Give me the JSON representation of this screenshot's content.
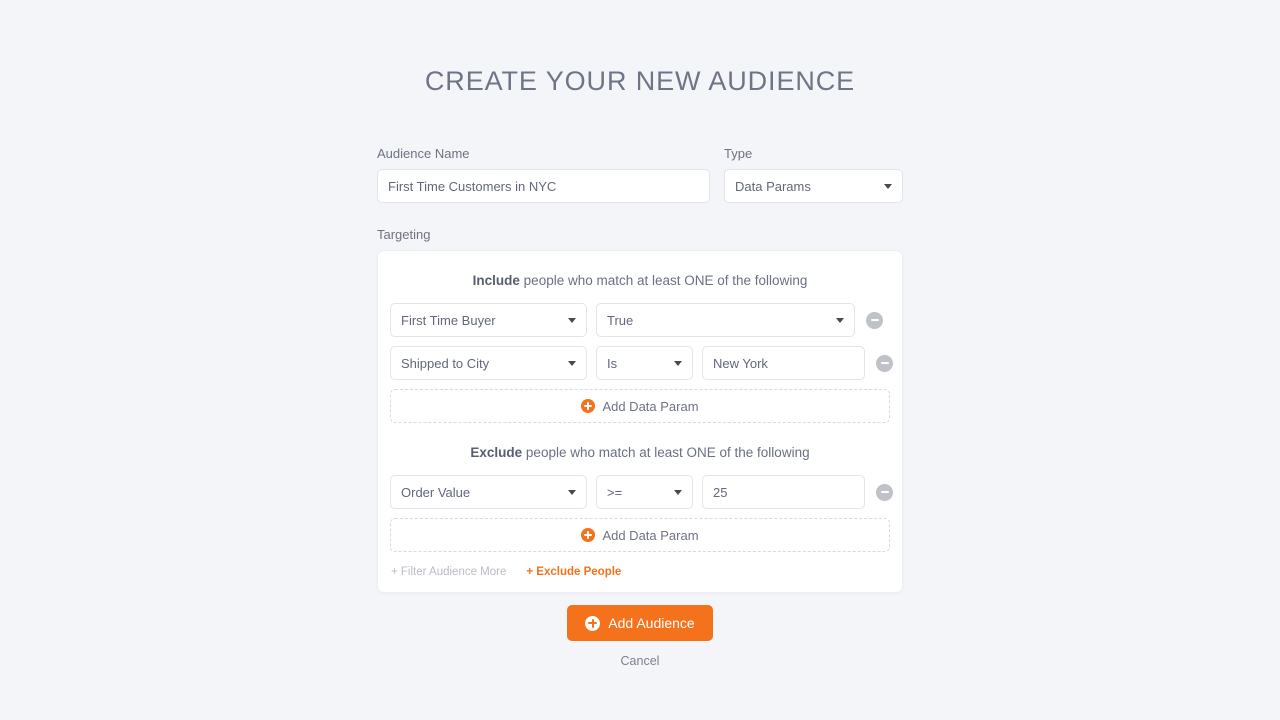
{
  "page": {
    "title": "CREATE YOUR NEW AUDIENCE",
    "background_color": "#f4f5f9",
    "accent_color": "#f4721b"
  },
  "form": {
    "audience_name": {
      "label": "Audience Name",
      "value": "First Time Customers in NYC",
      "placeholder": "Audience Name"
    },
    "type": {
      "label": "Type",
      "value": "Data Params",
      "icon": "chevron-down-icon"
    },
    "targeting_label": "Targeting"
  },
  "include_group": {
    "heading_strong": "Include",
    "heading_rest": " people who match at least ONE of the following",
    "rules": [
      {
        "param": "First Time Buyer",
        "value": "True",
        "value_is_select": true,
        "remove_icon": "minus-circle-icon"
      },
      {
        "param": "Shipped to City",
        "operator": "Is",
        "value": "New York",
        "value_is_select": false,
        "remove_icon": "minus-circle-icon"
      }
    ],
    "add_label": "Add Data Param",
    "add_icon": "plus-circle-icon"
  },
  "exclude_group": {
    "heading_strong": "Exclude",
    "heading_rest": " people who match at least ONE of the following",
    "rules": [
      {
        "param": "Order Value",
        "operator": ">=",
        "value": "25",
        "value_is_select": false,
        "remove_icon": "minus-circle-icon"
      }
    ],
    "add_label": "Add Data Param",
    "add_icon": "plus-circle-icon"
  },
  "card_links": {
    "filter_more": "+ Filter Audience More",
    "exclude_people": "+ Exclude People"
  },
  "actions": {
    "submit_label": "Add Audience",
    "submit_icon": "plus-circle-icon",
    "cancel_label": "Cancel"
  }
}
